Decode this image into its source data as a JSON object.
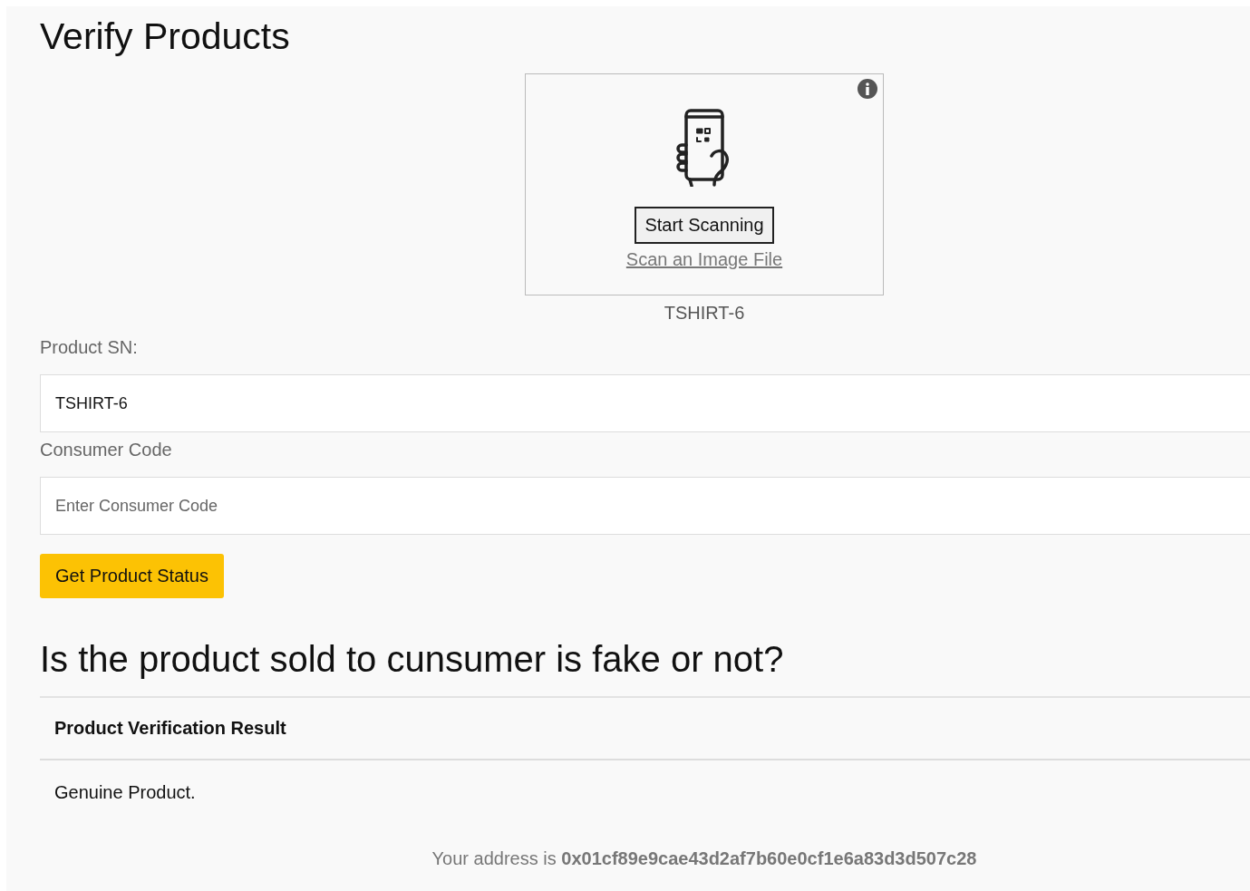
{
  "title": "Verify Products",
  "scanner": {
    "button": "Start Scanning",
    "link": "Scan an Image File",
    "result": "TSHIRT-6"
  },
  "fields": [
    {
      "label": "Product SN:",
      "value": "TSHIRT-6"
    },
    {
      "label": "Consumer Code",
      "placeholder": "Enter Consumer Code"
    }
  ],
  "submit": "Get Product Status",
  "question": "Is the product sold to cunsumer is fake or not?",
  "table": {
    "header": "Product Verification Result",
    "rows": [
      "Genuine Product."
    ]
  },
  "footer": "Your address is **0x01cf89e9cae43d2af7b60e0cf1e6a83d3d507c28**"
}
